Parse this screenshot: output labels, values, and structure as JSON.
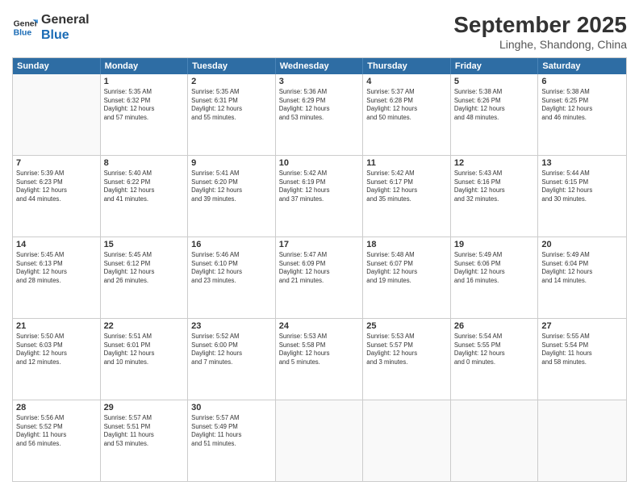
{
  "header": {
    "logo_line1": "General",
    "logo_line2": "Blue",
    "month": "September 2025",
    "location": "Linghe, Shandong, China"
  },
  "days_of_week": [
    "Sunday",
    "Monday",
    "Tuesday",
    "Wednesday",
    "Thursday",
    "Friday",
    "Saturday"
  ],
  "weeks": [
    [
      {
        "day": "",
        "info": ""
      },
      {
        "day": "1",
        "info": "Sunrise: 5:35 AM\nSunset: 6:32 PM\nDaylight: 12 hours\nand 57 minutes."
      },
      {
        "day": "2",
        "info": "Sunrise: 5:35 AM\nSunset: 6:31 PM\nDaylight: 12 hours\nand 55 minutes."
      },
      {
        "day": "3",
        "info": "Sunrise: 5:36 AM\nSunset: 6:29 PM\nDaylight: 12 hours\nand 53 minutes."
      },
      {
        "day": "4",
        "info": "Sunrise: 5:37 AM\nSunset: 6:28 PM\nDaylight: 12 hours\nand 50 minutes."
      },
      {
        "day": "5",
        "info": "Sunrise: 5:38 AM\nSunset: 6:26 PM\nDaylight: 12 hours\nand 48 minutes."
      },
      {
        "day": "6",
        "info": "Sunrise: 5:38 AM\nSunset: 6:25 PM\nDaylight: 12 hours\nand 46 minutes."
      }
    ],
    [
      {
        "day": "7",
        "info": "Sunrise: 5:39 AM\nSunset: 6:23 PM\nDaylight: 12 hours\nand 44 minutes."
      },
      {
        "day": "8",
        "info": "Sunrise: 5:40 AM\nSunset: 6:22 PM\nDaylight: 12 hours\nand 41 minutes."
      },
      {
        "day": "9",
        "info": "Sunrise: 5:41 AM\nSunset: 6:20 PM\nDaylight: 12 hours\nand 39 minutes."
      },
      {
        "day": "10",
        "info": "Sunrise: 5:42 AM\nSunset: 6:19 PM\nDaylight: 12 hours\nand 37 minutes."
      },
      {
        "day": "11",
        "info": "Sunrise: 5:42 AM\nSunset: 6:17 PM\nDaylight: 12 hours\nand 35 minutes."
      },
      {
        "day": "12",
        "info": "Sunrise: 5:43 AM\nSunset: 6:16 PM\nDaylight: 12 hours\nand 32 minutes."
      },
      {
        "day": "13",
        "info": "Sunrise: 5:44 AM\nSunset: 6:15 PM\nDaylight: 12 hours\nand 30 minutes."
      }
    ],
    [
      {
        "day": "14",
        "info": "Sunrise: 5:45 AM\nSunset: 6:13 PM\nDaylight: 12 hours\nand 28 minutes."
      },
      {
        "day": "15",
        "info": "Sunrise: 5:45 AM\nSunset: 6:12 PM\nDaylight: 12 hours\nand 26 minutes."
      },
      {
        "day": "16",
        "info": "Sunrise: 5:46 AM\nSunset: 6:10 PM\nDaylight: 12 hours\nand 23 minutes."
      },
      {
        "day": "17",
        "info": "Sunrise: 5:47 AM\nSunset: 6:09 PM\nDaylight: 12 hours\nand 21 minutes."
      },
      {
        "day": "18",
        "info": "Sunrise: 5:48 AM\nSunset: 6:07 PM\nDaylight: 12 hours\nand 19 minutes."
      },
      {
        "day": "19",
        "info": "Sunrise: 5:49 AM\nSunset: 6:06 PM\nDaylight: 12 hours\nand 16 minutes."
      },
      {
        "day": "20",
        "info": "Sunrise: 5:49 AM\nSunset: 6:04 PM\nDaylight: 12 hours\nand 14 minutes."
      }
    ],
    [
      {
        "day": "21",
        "info": "Sunrise: 5:50 AM\nSunset: 6:03 PM\nDaylight: 12 hours\nand 12 minutes."
      },
      {
        "day": "22",
        "info": "Sunrise: 5:51 AM\nSunset: 6:01 PM\nDaylight: 12 hours\nand 10 minutes."
      },
      {
        "day": "23",
        "info": "Sunrise: 5:52 AM\nSunset: 6:00 PM\nDaylight: 12 hours\nand 7 minutes."
      },
      {
        "day": "24",
        "info": "Sunrise: 5:53 AM\nSunset: 5:58 PM\nDaylight: 12 hours\nand 5 minutes."
      },
      {
        "day": "25",
        "info": "Sunrise: 5:53 AM\nSunset: 5:57 PM\nDaylight: 12 hours\nand 3 minutes."
      },
      {
        "day": "26",
        "info": "Sunrise: 5:54 AM\nSunset: 5:55 PM\nDaylight: 12 hours\nand 0 minutes."
      },
      {
        "day": "27",
        "info": "Sunrise: 5:55 AM\nSunset: 5:54 PM\nDaylight: 11 hours\nand 58 minutes."
      }
    ],
    [
      {
        "day": "28",
        "info": "Sunrise: 5:56 AM\nSunset: 5:52 PM\nDaylight: 11 hours\nand 56 minutes."
      },
      {
        "day": "29",
        "info": "Sunrise: 5:57 AM\nSunset: 5:51 PM\nDaylight: 11 hours\nand 53 minutes."
      },
      {
        "day": "30",
        "info": "Sunrise: 5:57 AM\nSunset: 5:49 PM\nDaylight: 11 hours\nand 51 minutes."
      },
      {
        "day": "",
        "info": ""
      },
      {
        "day": "",
        "info": ""
      },
      {
        "day": "",
        "info": ""
      },
      {
        "day": "",
        "info": ""
      }
    ]
  ]
}
